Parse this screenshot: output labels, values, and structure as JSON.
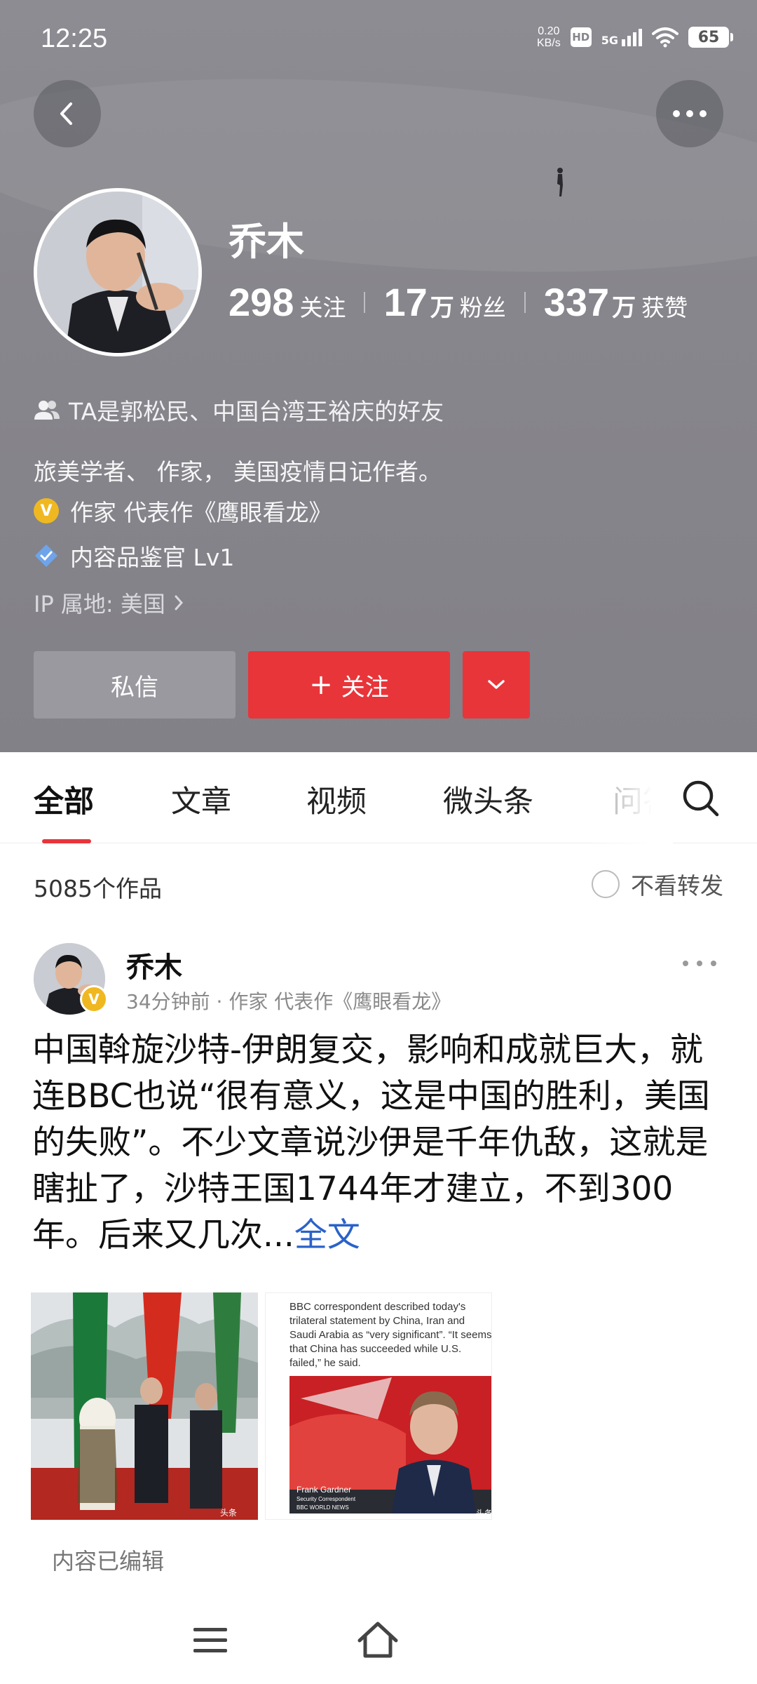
{
  "status_bar": {
    "time": "12:25",
    "net_speed_value": "0.20",
    "net_speed_unit": "KB/s",
    "hd": "HD",
    "network": "5G",
    "battery": "65"
  },
  "profile": {
    "name": "乔木",
    "following_count": "298",
    "following_label": "关注",
    "followers_count": "17",
    "followers_unit": "万",
    "followers_label": "粉丝",
    "likes_count": "337",
    "likes_unit": "万",
    "likes_label": "获赞",
    "mutual_friends": "TA是郭松民、中国台湾王裕庆的好友",
    "bio": "旅美学者、 作家， 美国疫情日记作者。",
    "cert_author": "作家 代表作《鹰眼看龙》",
    "cert_reviewer": "内容品鉴官 Lv1",
    "ip_location": "IP 属地: 美国"
  },
  "actions": {
    "message_label": "私信",
    "follow_label": "关注",
    "follow_plus": "+"
  },
  "tabs": [
    {
      "label": "全部",
      "active": true
    },
    {
      "label": "文章",
      "active": false
    },
    {
      "label": "视频",
      "active": false
    },
    {
      "label": "微头条",
      "active": false
    },
    {
      "label": "问答",
      "active": false
    }
  ],
  "works": {
    "count_label": "5085个作品",
    "filter_label": "不看转发"
  },
  "post": {
    "author": "乔木",
    "meta": "34分钟前 · 作家 代表作《鹰眼看龙》",
    "text": "中国斡旋沙特-伊朗复交，影响和成就巨大，就连BBC也说“很有意义，这是中国的胜利，美国的失败”。不少文章说沙伊是千年仇敌，这就是瞎扯了，沙特王国1744年才建立，不到300年。后来又几次...",
    "read_more": "全文",
    "image2_caption": "BBC correspondent described today's trilateral statement by China, Iran and Saudi Arabia as “very significant”. “It seems that China has succeeded while U.S. failed,” he said.",
    "image2_name": "Frank Gardner",
    "image2_role": "Security Correspondent",
    "image2_channel": "BBC WORLD NEWS",
    "watermark": "头条",
    "edited_label": "内容已编辑"
  },
  "colors": {
    "accent_red": "#e8353a",
    "header_gray": "#87868c",
    "link_blue": "#2a62c9",
    "badge_gold": "#f0b820"
  },
  "icons": [
    "back-arrow-icon",
    "more-dots-icon",
    "people-icon",
    "verified-v-icon",
    "diamond-badge-icon",
    "chevron-right-icon",
    "chevron-down-icon",
    "search-icon",
    "menu-icon",
    "home-icon"
  ]
}
